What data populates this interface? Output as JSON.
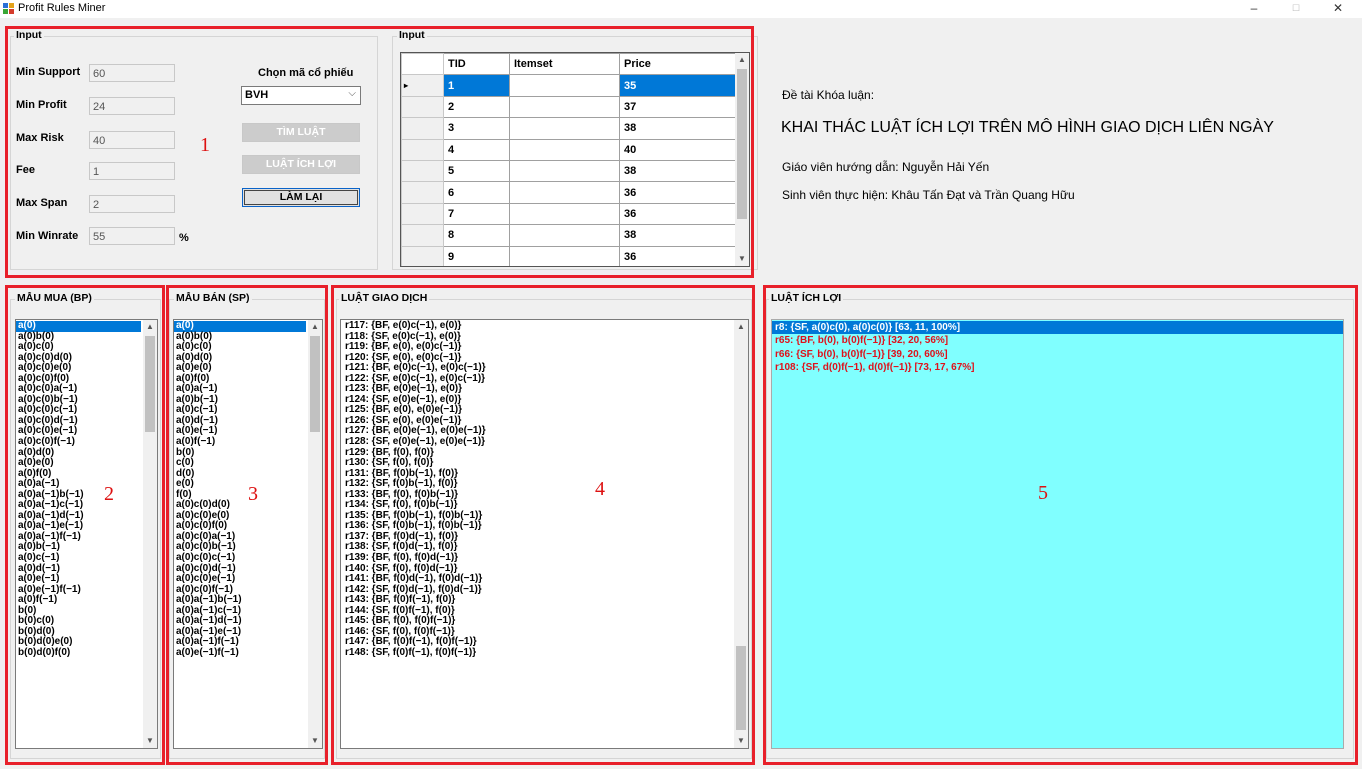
{
  "window": {
    "title": "Profit Rules Miner",
    "controls": [
      "–",
      "☐",
      "✕"
    ]
  },
  "input_group": {
    "title": "Input",
    "fields": [
      {
        "label": "Min Support",
        "value": "60"
      },
      {
        "label": "Min Profit",
        "value": "24"
      },
      {
        "label": "Max Risk",
        "value": "40"
      },
      {
        "label": "Fee",
        "value": "1"
      },
      {
        "label": "Max Span",
        "value": "2"
      },
      {
        "label": "Min Winrate",
        "value": "55"
      }
    ],
    "winrate_unit": "%",
    "stock_label": "Chọn mã cổ phiếu",
    "stock_value": "BVH",
    "buttons": {
      "find": "TÌM LUẬT",
      "profit": "LUẬT ÍCH LỢI",
      "reset": "LÀM LẠI"
    },
    "region_number": "1"
  },
  "input_grid": {
    "title": "Input",
    "columns": [
      "TID",
      "Itemset",
      "Price"
    ],
    "rows": [
      {
        "tid": "1",
        "itemset": "",
        "price": "35"
      },
      {
        "tid": "2",
        "itemset": "",
        "price": "37"
      },
      {
        "tid": "3",
        "itemset": "",
        "price": "38"
      },
      {
        "tid": "4",
        "itemset": "",
        "price": "40"
      },
      {
        "tid": "5",
        "itemset": "",
        "price": "38"
      },
      {
        "tid": "6",
        "itemset": "",
        "price": "36"
      },
      {
        "tid": "7",
        "itemset": "",
        "price": "36"
      },
      {
        "tid": "8",
        "itemset": "",
        "price": "38"
      },
      {
        "tid": "9",
        "itemset": "",
        "price": "36"
      }
    ],
    "current_row_marker": "▸"
  },
  "info": {
    "line1": "Đề tài Khóa luận:",
    "title": "KHAI THÁC LUẬT ÍCH LỢI TRÊN MÔ HÌNH GIAO DỊCH LIÊN NGÀY",
    "advisor": "Giáo viên hướng dẫn: Nguyễn Hải Yến",
    "students": "Sinh viên thực hiện: Khâu Tấn Đạt và Trần Quang Hữu"
  },
  "buy_patterns": {
    "title": "MẪU MUA (BP)",
    "region_number": "2",
    "items": [
      "a(0)",
      "a(0)b(0)",
      "a(0)c(0)",
      "a(0)c(0)d(0)",
      "a(0)c(0)e(0)",
      "a(0)c(0)f(0)",
      "a(0)c(0)a(−1)",
      "a(0)c(0)b(−1)",
      "a(0)c(0)c(−1)",
      "a(0)c(0)d(−1)",
      "a(0)c(0)e(−1)",
      "a(0)c(0)f(−1)",
      "a(0)d(0)",
      "a(0)e(0)",
      "a(0)f(0)",
      "a(0)a(−1)",
      "a(0)a(−1)b(−1)",
      "a(0)a(−1)c(−1)",
      "a(0)a(−1)d(−1)",
      "a(0)a(−1)e(−1)",
      "a(0)a(−1)f(−1)",
      "a(0)b(−1)",
      "a(0)c(−1)",
      "a(0)d(−1)",
      "a(0)e(−1)",
      "a(0)e(−1)f(−1)",
      "a(0)f(−1)",
      "b(0)",
      "b(0)c(0)",
      "b(0)d(0)",
      "b(0)d(0)e(0)",
      "b(0)d(0)f(0)"
    ]
  },
  "sell_patterns": {
    "title": "MẪU BÁN (SP)",
    "region_number": "3",
    "items": [
      "a(0)",
      "a(0)b(0)",
      "a(0)c(0)",
      "a(0)d(0)",
      "a(0)e(0)",
      "a(0)f(0)",
      "a(0)a(−1)",
      "a(0)b(−1)",
      "a(0)c(−1)",
      "a(0)d(−1)",
      "a(0)e(−1)",
      "a(0)f(−1)",
      "b(0)",
      "c(0)",
      "d(0)",
      "e(0)",
      "f(0)",
      "a(0)c(0)d(0)",
      "a(0)c(0)e(0)",
      "a(0)c(0)f(0)",
      "a(0)c(0)a(−1)",
      "a(0)c(0)b(−1)",
      "a(0)c(0)c(−1)",
      "a(0)c(0)d(−1)",
      "a(0)c(0)e(−1)",
      "a(0)c(0)f(−1)",
      "a(0)a(−1)b(−1)",
      "a(0)a(−1)c(−1)",
      "a(0)a(−1)d(−1)",
      "a(0)a(−1)e(−1)",
      "a(0)a(−1)f(−1)",
      "a(0)e(−1)f(−1)"
    ]
  },
  "trade_rules": {
    "title": "LUẬT GIAO DỊCH",
    "region_number": "4",
    "items": [
      "r117: {BF, e(0)c(−1), e(0)}",
      "r118: {SF, e(0)c(−1), e(0)}",
      "r119: {BF, e(0), e(0)c(−1)}",
      "r120: {SF, e(0), e(0)c(−1)}",
      "r121: {BF, e(0)c(−1), e(0)c(−1)}",
      "r122: {SF, e(0)c(−1), e(0)c(−1)}",
      "r123: {BF, e(0)e(−1), e(0)}",
      "r124: {SF, e(0)e(−1), e(0)}",
      "r125: {BF, e(0), e(0)e(−1)}",
      "r126: {SF, e(0), e(0)e(−1)}",
      "r127: {BF, e(0)e(−1), e(0)e(−1)}",
      "r128: {SF, e(0)e(−1), e(0)e(−1)}",
      "r129: {BF, f(0), f(0)}",
      "r130: {SF, f(0), f(0)}",
      "r131: {BF, f(0)b(−1), f(0)}",
      "r132: {SF, f(0)b(−1), f(0)}",
      "r133: {BF, f(0), f(0)b(−1)}",
      "r134: {SF, f(0), f(0)b(−1)}",
      "r135: {BF, f(0)b(−1), f(0)b(−1)}",
      "r136: {SF, f(0)b(−1), f(0)b(−1)}",
      "r137: {BF, f(0)d(−1), f(0)}",
      "r138: {SF, f(0)d(−1), f(0)}",
      "r139: {BF, f(0), f(0)d(−1)}",
      "r140: {SF, f(0), f(0)d(−1)}",
      "r141: {BF, f(0)d(−1), f(0)d(−1)}",
      "r142: {SF, f(0)d(−1), f(0)d(−1)}",
      "r143: {BF, f(0)f(−1), f(0)}",
      "r144: {SF, f(0)f(−1), f(0)}",
      "r145: {BF, f(0), f(0)f(−1)}",
      "r146: {SF, f(0), f(0)f(−1)}",
      "r147: {BF, f(0)f(−1), f(0)f(−1)}",
      "r148: {SF, f(0)f(−1), f(0)f(−1)}"
    ]
  },
  "profit_rules": {
    "title": "LUẬT ÍCH LỢI",
    "region_number": "5",
    "items": [
      "r8: {SF, a(0)c(0), a(0)c(0)} [63, 11, 100%]",
      "r65: {BF, b(0), b(0)f(−1)} [32, 20, 56%]",
      "r66: {SF, b(0), b(0)f(−1)} [39, 20, 60%]",
      "r108: {SF, d(0)f(−1), d(0)f(−1)} [73, 17, 67%]"
    ]
  },
  "colors": {
    "highlight": "#e8202a",
    "selection": "#0078d7",
    "profit_bg": "#80ffff",
    "profit_text": "#e0101a"
  },
  "icons": [
    "app-icon",
    "minimize-icon",
    "maximize-icon",
    "close-icon",
    "chevron-down-icon",
    "scroll-up-arrow",
    "scroll-down-arrow",
    "row-pointer-icon"
  ]
}
